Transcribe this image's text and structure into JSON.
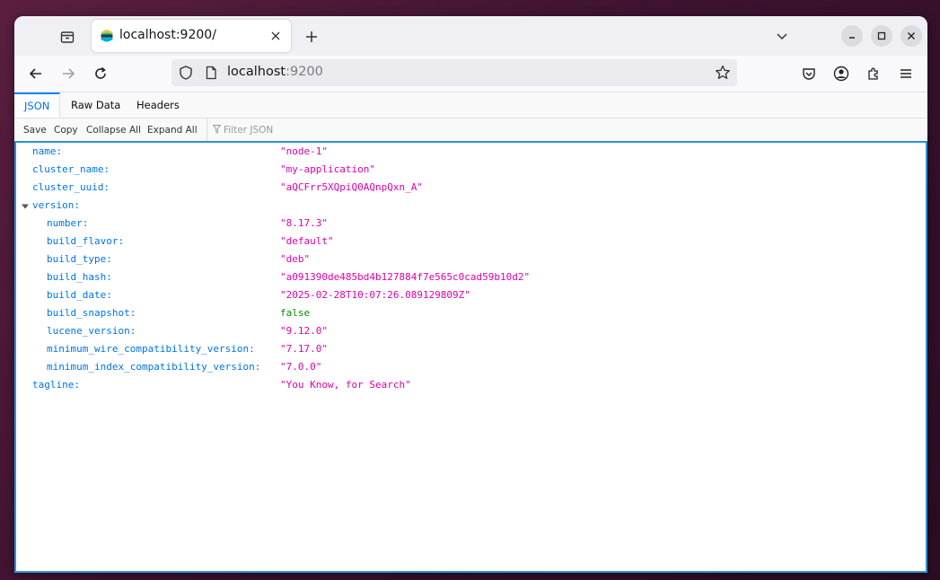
{
  "browser": {
    "tab_title": "localhost:9200/",
    "url_host": "localhost",
    "url_port": ":9200"
  },
  "json_viewer": {
    "tabs": [
      "JSON",
      "Raw Data",
      "Headers"
    ],
    "toolbar": {
      "save": "Save",
      "copy": "Copy",
      "collapse_all": "Collapse All",
      "expand_all": "Expand All",
      "filter_placeholder": "Filter JSON"
    },
    "rows": [
      {
        "key": "name:",
        "value": "\"node-1\""
      },
      {
        "key": "cluster_name:",
        "value": "\"my-application\""
      },
      {
        "key": "cluster_uuid:",
        "value": "\"aQCFrr5XQpiQ0AQnpQxn_A\""
      },
      {
        "key": "version:",
        "value": ""
      },
      {
        "key": "number:",
        "value": "\"8.17.3\""
      },
      {
        "key": "build_flavor:",
        "value": "\"default\""
      },
      {
        "key": "build_type:",
        "value": "\"deb\""
      },
      {
        "key": "build_hash:",
        "value": "\"a091390de485bd4b127884f7e565c0cad59b10d2\""
      },
      {
        "key": "build_date:",
        "value": "\"2025-02-28T10:07:26.089129809Z\""
      },
      {
        "key": "build_snapshot:",
        "value": "false"
      },
      {
        "key": "lucene_version:",
        "value": "\"9.12.0\""
      },
      {
        "key": "minimum_wire_compatibility_version:",
        "value": "\"7.17.0\""
      },
      {
        "key": "minimum_index_compatibility_version:",
        "value": "\"7.0.0\""
      },
      {
        "key": "tagline:",
        "value": "\"You Know, for Search\""
      }
    ]
  },
  "colors": {
    "key": "#0074e8",
    "string": "#dd00a9",
    "boolean": "#058b00",
    "focus_border": "#2d8fd8"
  }
}
